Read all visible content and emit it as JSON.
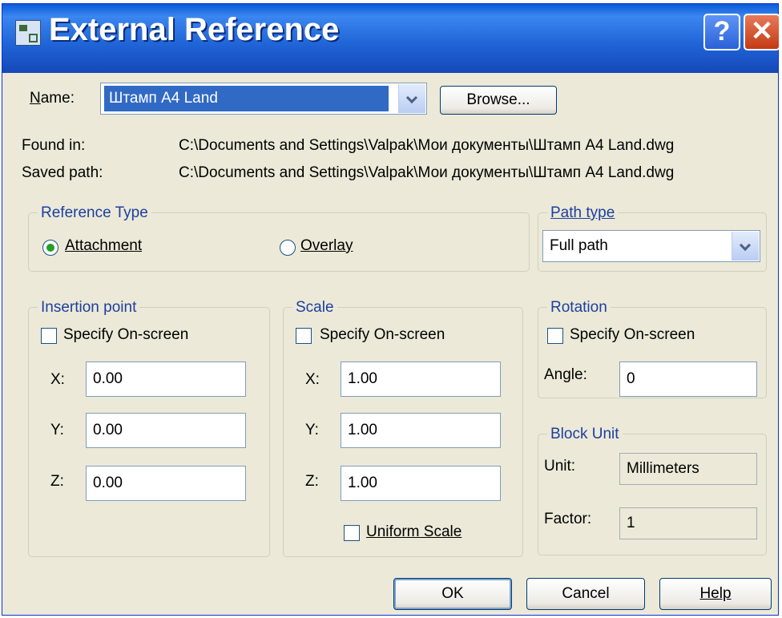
{
  "window": {
    "title": "External Reference"
  },
  "name": {
    "label": "Name:",
    "value": "Штамп A4 Land",
    "browse": "Browse..."
  },
  "found_in": {
    "label": "Found in:",
    "value": "C:\\Documents and Settings\\Valpak\\Мои документы\\Штамп A4 Land.dwg"
  },
  "saved_path": {
    "label": "Saved path:",
    "value": "C:\\Documents and Settings\\Valpak\\Мои документы\\Штамп A4 Land.dwg"
  },
  "reference_type": {
    "title": "Reference Type",
    "attachment": "Attachment",
    "overlay": "Overlay",
    "selected": "Attachment"
  },
  "path_type": {
    "title": "Path type",
    "value": "Full path"
  },
  "insertion": {
    "title": "Insertion point",
    "specify": "Specify On-screen",
    "specify_checked": false,
    "x_label": "X:",
    "y_label": "Y:",
    "z_label": "Z:",
    "x": "0.00",
    "y": "0.00",
    "z": "0.00"
  },
  "scale": {
    "title": "Scale",
    "specify": "Specify On-screen",
    "specify_checked": false,
    "x_label": "X:",
    "y_label": "Y:",
    "z_label": "Z:",
    "x": "1.00",
    "y": "1.00",
    "z": "1.00",
    "uniform": "Uniform Scale",
    "uniform_checked": false
  },
  "rotation": {
    "title": "Rotation",
    "specify": "Specify On-screen",
    "specify_checked": false,
    "angle_label": "Angle:",
    "angle": "0"
  },
  "block_unit": {
    "title": "Block Unit",
    "unit_label": "Unit:",
    "unit": "Millimeters",
    "factor_label": "Factor:",
    "factor": "1"
  },
  "buttons": {
    "ok": "OK",
    "cancel": "Cancel",
    "help": "Help"
  },
  "colors": {
    "titlebar": "#1f63d6",
    "dialog_bg": "#ece9d8",
    "group_title": "#1c3fa0",
    "selection": "#316ac5"
  },
  "icons": {
    "app": "autocad-xref-icon",
    "help": "help-icon",
    "close": "close-icon"
  }
}
